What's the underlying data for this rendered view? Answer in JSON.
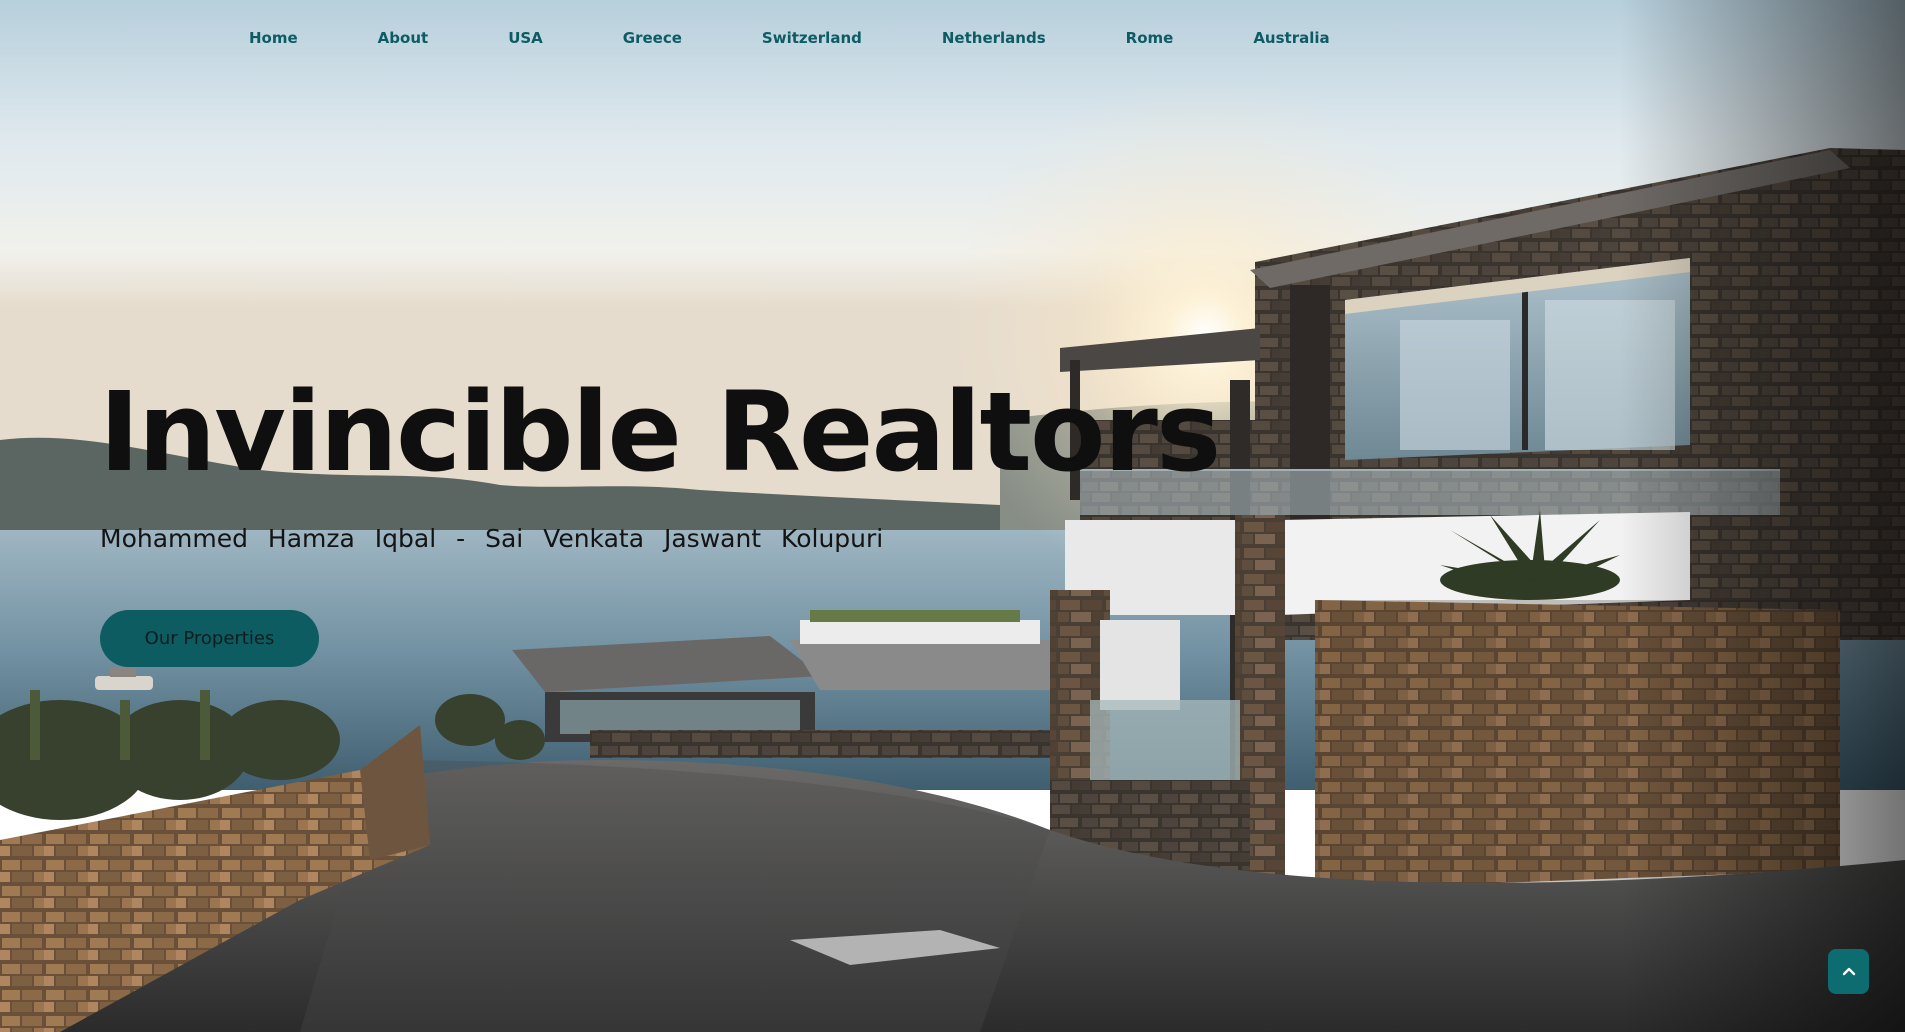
{
  "nav": {
    "items": [
      "Home",
      "About",
      "USA",
      "Greece",
      "Switzerland",
      "Netherlands",
      "Rome",
      "Australia"
    ]
  },
  "hero": {
    "title": "Invincible Realtors",
    "subtitle": "Mohammed Hamza Iqbal - Sai Venkata Jaswant Kolupuri",
    "cta_label": "Our Properties"
  },
  "scroll_top": {
    "icon": "chevron-up-icon"
  },
  "colors": {
    "accent": "#0c5c61",
    "nav_text": "#0d5c63",
    "title_text": "#0f0f0f"
  }
}
